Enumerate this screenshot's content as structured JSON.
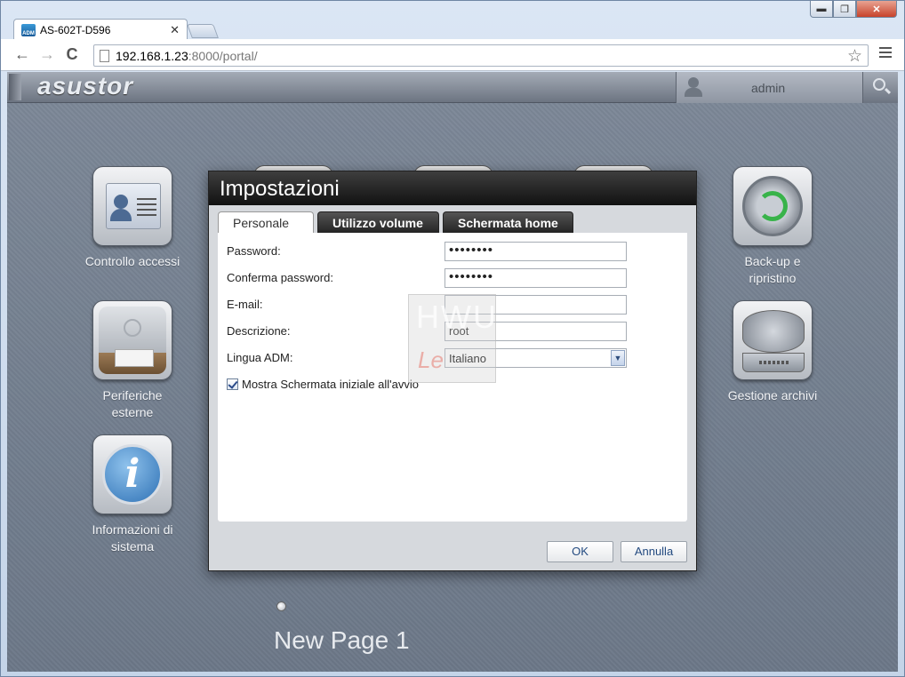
{
  "window": {
    "minimize": "▬",
    "maximize": "❐",
    "close": "✕"
  },
  "browser": {
    "tab_title": "AS-602T-D596",
    "favicon_text": "ADM",
    "url_host": "192.168.1.23",
    "url_rest": ":8000/portal/",
    "back": "←",
    "forward": "→",
    "reload": "C",
    "star": "☆"
  },
  "portal": {
    "logo": "asustor",
    "username": "admin",
    "apps": [
      {
        "label": "Controllo accessi"
      },
      {
        "label": "Periferiche esterne"
      },
      {
        "label": "Informazioni di sistema"
      },
      {
        "label": "Back-up e ripristino"
      },
      {
        "label": "Gestione archivi"
      }
    ],
    "page_name": "New Page 1"
  },
  "dialog": {
    "title": "Impostazioni",
    "tabs": [
      {
        "label": "Personale",
        "active": true
      },
      {
        "label": "Utilizzo volume",
        "active": false
      },
      {
        "label": "Schermata home",
        "active": false
      }
    ],
    "fields": {
      "password_label": "Password:",
      "password_value": "••••••••",
      "confirm_label": "Conferma password:",
      "confirm_value": "••••••••",
      "email_label": "E-mail:",
      "email_value": "",
      "description_label": "Descrizione:",
      "description_value": "root",
      "language_label": "Lingua ADM:",
      "language_value": "Italiano"
    },
    "checkbox_label": "Mostra Schermata iniziale all'avvio",
    "ok_label": "OK",
    "cancel_label": "Annulla"
  },
  "watermark": {
    "main": "HWU",
    "sub": "Le"
  }
}
